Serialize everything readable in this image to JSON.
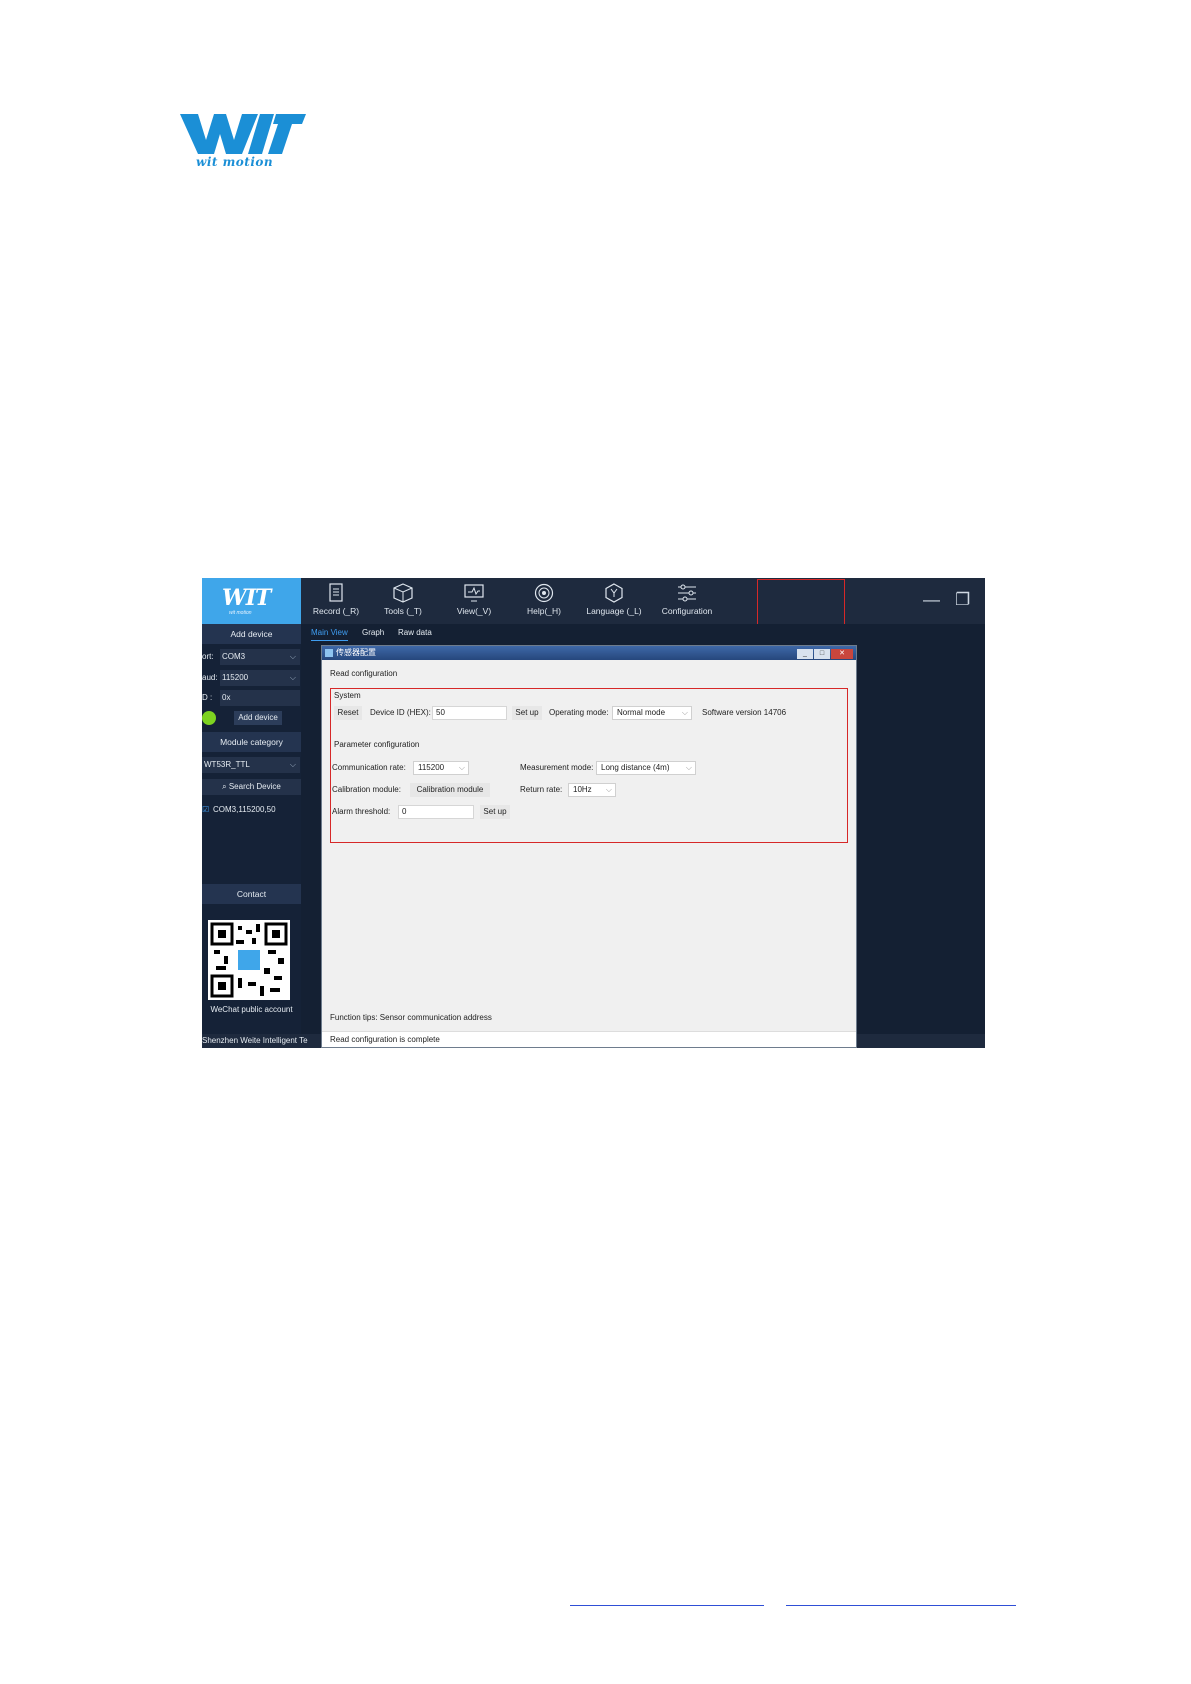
{
  "page": {
    "logo_text": "WIT",
    "logo_subtitle": "wit motion"
  },
  "app": {
    "brand_text": "WIT",
    "brand_subtitle": "wit motion",
    "toolbar": [
      {
        "label": "Record (_R)",
        "icon": "document-icon"
      },
      {
        "label": "Tools (_T)",
        "icon": "box-icon"
      },
      {
        "label": "View(_V)",
        "icon": "monitor-icon"
      },
      {
        "label": "Help(_H)",
        "icon": "target-icon"
      },
      {
        "label": "Language (_L)",
        "icon": "hexagon-icon"
      },
      {
        "label": "Configuration",
        "icon": "sliders-icon"
      }
    ],
    "window_controls": {
      "minimize": "—",
      "restore": "❐",
      "close": "✕"
    },
    "tabs": [
      "Main View",
      "Graph",
      "Raw data"
    ],
    "sidebar": {
      "add_device_header": "Add device",
      "port_label": "ort:",
      "port_value": "COM3",
      "baud_label": "aud:",
      "baud_value": "115200",
      "id_label": "D :",
      "id_value": "0x",
      "add_device_button": "Add device",
      "module_category_header": "Module category",
      "module_value": "WT53R_TTL",
      "search_button": "Search Device",
      "device_entry": "COM3,115200,50",
      "contact_header": "Contact",
      "wechat_label": "WeChat public account"
    },
    "status_bar": "Shenzhen Weite Intelligent Te",
    "dialog": {
      "title": "传感器配置",
      "read_configuration": "Read configuration",
      "system_label": "System",
      "reset_button": "Reset",
      "device_id_label": "Device ID (HEX):",
      "device_id_value": "50",
      "setup_button": "Set up",
      "operating_mode_label": "Operating mode:",
      "operating_mode_value": "Normal mode",
      "software_version": "Software version 14706",
      "parameter_configuration_label": "Parameter configuration",
      "communication_rate_label": "Communication rate:",
      "communication_rate_value": "115200",
      "measurement_mode_label": "Measurement mode:",
      "measurement_mode_value": "Long distance (4m)",
      "calibration_module_label": "Calibration module:",
      "calibration_module_button": "Calibration module",
      "return_rate_label": "Return rate:",
      "return_rate_value": "10Hz",
      "alarm_threshold_label": "Alarm threshold:",
      "alarm_threshold_value": "0",
      "alarm_setup_button": "Set up",
      "function_tips": "Function tips: Sensor communication address",
      "status_message": "Read configuration is complete"
    }
  }
}
